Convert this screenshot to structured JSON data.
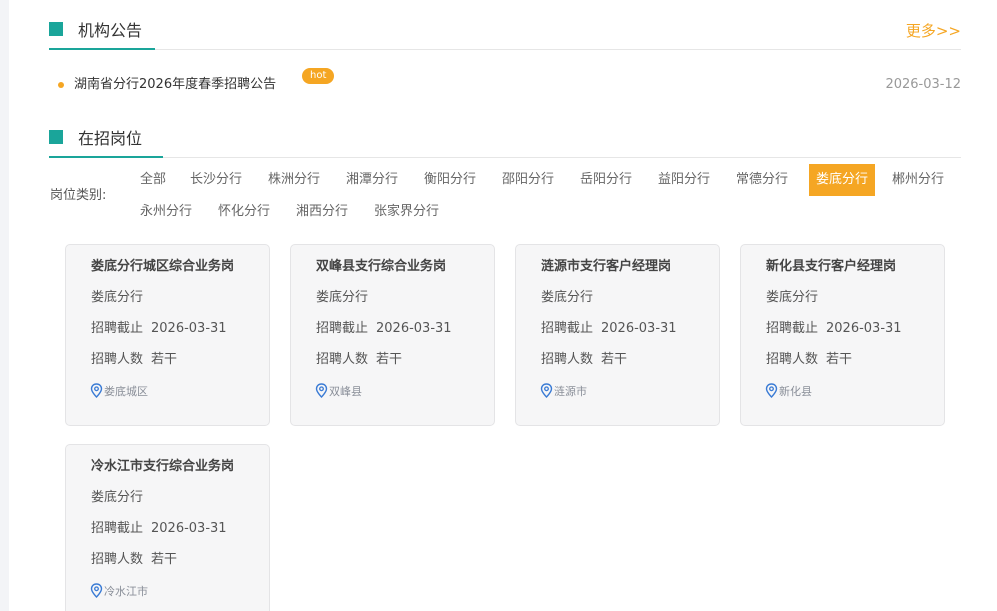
{
  "notice_section": {
    "title": "机构公告",
    "more": "更多>>",
    "items": [
      {
        "text": "湖南省分行2026年度春季招聘公告",
        "badge": "hot",
        "date": "2026-03-12"
      }
    ]
  },
  "jobs_section": {
    "title": "在招岗位",
    "category_label": "岗位类别:",
    "categories": [
      "全部",
      "长沙分行",
      "株洲分行",
      "湘潭分行",
      "衡阳分行",
      "邵阳分行",
      "岳阳分行",
      "益阳分行",
      "常德分行",
      "娄底分行",
      "郴州分行",
      "永州分行",
      "怀化分行",
      "湘西分行",
      "张家界分行"
    ],
    "active_category": "娄底分行",
    "deadline_label": "招聘截止",
    "count_label": "招聘人数",
    "jobs": [
      {
        "title": "娄底分行城区综合业务岗",
        "org": "娄底分行",
        "deadline": "2026-03-31",
        "count": "若干",
        "location": "娄底城区"
      },
      {
        "title": "双峰县支行综合业务岗",
        "org": "娄底分行",
        "deadline": "2026-03-31",
        "count": "若干",
        "location": "双峰县"
      },
      {
        "title": "涟源市支行客户经理岗",
        "org": "娄底分行",
        "deadline": "2026-03-31",
        "count": "若干",
        "location": "涟源市"
      },
      {
        "title": "新化县支行客户经理岗",
        "org": "娄底分行",
        "deadline": "2026-03-31",
        "count": "若干",
        "location": "新化县"
      },
      {
        "title": "冷水江市支行综合业务岗",
        "org": "娄底分行",
        "deadline": "2026-03-31",
        "count": "若干",
        "location": "冷水江市"
      }
    ]
  },
  "colors": {
    "accent": "#1aa59a",
    "highlight": "#f5a623"
  }
}
